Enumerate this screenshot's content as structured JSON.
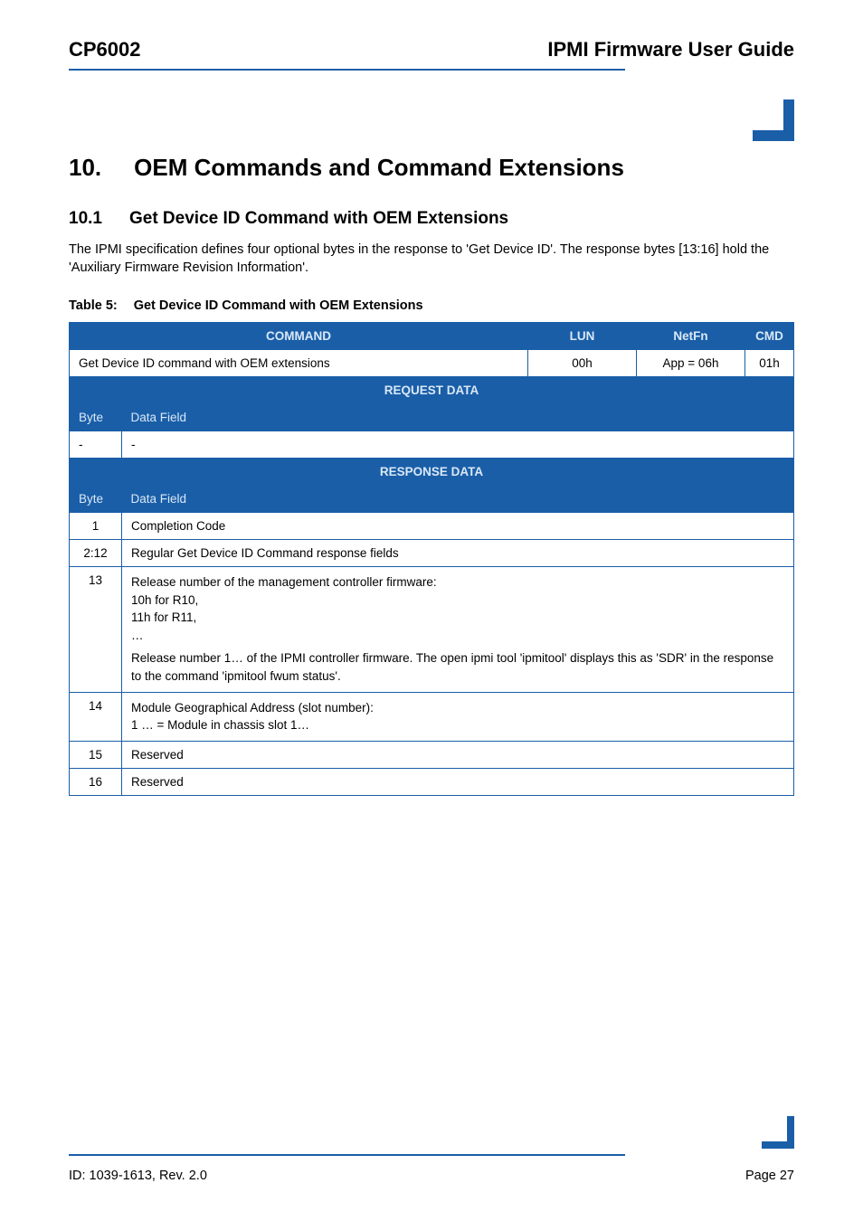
{
  "header": {
    "left": "CP6002",
    "right": "IPMI Firmware User Guide"
  },
  "section": {
    "number": "10.",
    "title": "OEM Commands and Command Extensions"
  },
  "subsection": {
    "number": "10.1",
    "title": "Get Device ID Command with OEM Extensions"
  },
  "paragraph": "The IPMI specification defines four optional bytes in the response to 'Get Device ID'. The response bytes [13:16] hold the 'Auxiliary Firmware Revision Information'.",
  "table_caption": {
    "label": "Table 5:",
    "title": "Get Device ID Command with OEM Extensions"
  },
  "table": {
    "head": {
      "command": "COMMAND",
      "lun": "LUN",
      "netfn": "NetFn",
      "cmd": "CMD"
    },
    "row1": {
      "command": "Get Device ID command with OEM extensions",
      "lun": "00h",
      "netfn": "App = 06h",
      "cmd": "01h"
    },
    "request_data_label": "REQUEST DATA",
    "byte_label": "Byte",
    "data_field_label": "Data Field",
    "req_rows": [
      {
        "byte": "-",
        "data": "-"
      }
    ],
    "response_data_label": "RESPONSE DATA",
    "resp_rows": [
      {
        "byte": "1",
        "data": "Completion Code"
      },
      {
        "byte": "2:12",
        "data": "Regular Get Device ID Command response fields"
      },
      {
        "byte": "13",
        "data_lines": [
          "Release number of the management controller firmware:",
          "10h for R10,",
          "11h for R11,",
          "…",
          "Release number 1… of the IPMI controller firmware. The open ipmi tool 'ipmitool' displays this as 'SDR' in the response to the command 'ipmitool fwum status'."
        ]
      },
      {
        "byte": "14",
        "data_lines": [
          "Module Geographical Address (slot number):",
          "1 … = Module in chassis slot 1…"
        ]
      },
      {
        "byte": "15",
        "data": "Reserved"
      },
      {
        "byte": "16",
        "data": "Reserved"
      }
    ]
  },
  "footer": {
    "left": "ID: 1039-1613, Rev. 2.0",
    "right": "Page 27"
  }
}
